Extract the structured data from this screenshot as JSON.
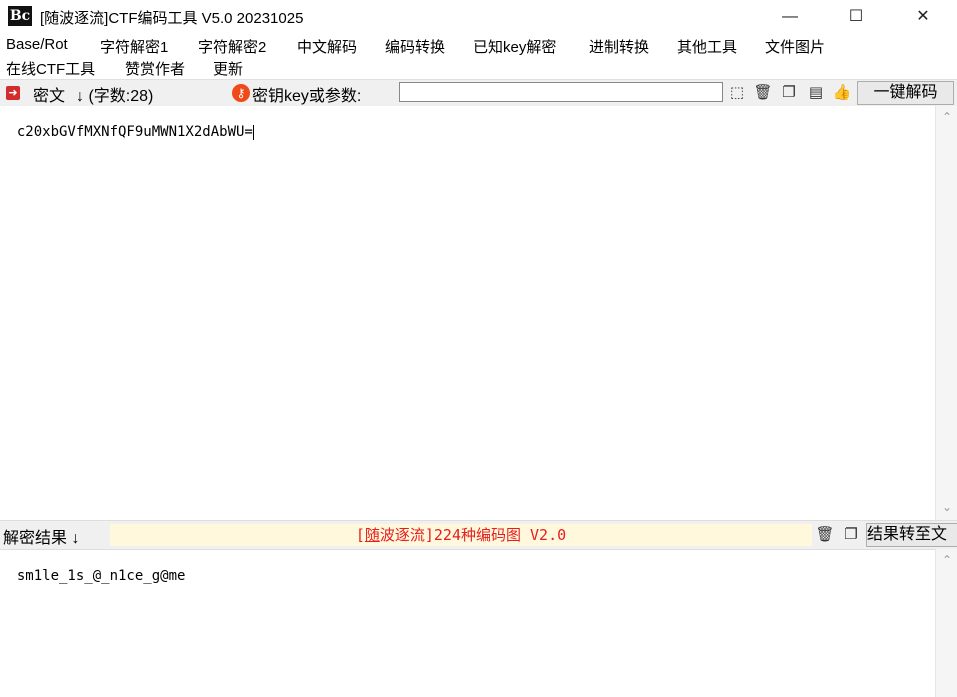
{
  "window": {
    "title": "[随波逐流]CTF编码工具 V5.0 20231025",
    "logo_text": "Bc",
    "minimize": "—",
    "maximize": "☐",
    "close": "✕"
  },
  "menu": {
    "row1": [
      "Base/Rot",
      "字符解密1",
      "字符解密2",
      "中文解码",
      "编码转换",
      "已知key解密",
      "进制转换",
      "其他工具",
      "文件图片"
    ],
    "row2": [
      "在线CTF工具",
      "赞赏作者",
      "更新"
    ]
  },
  "toolbar": {
    "ciphertext_label": "密文",
    "count_label": "↓ (字数:28)",
    "key_label": "密钥key或参数:",
    "key_value": "",
    "decode_button": "一键解码"
  },
  "input": {
    "text": "c20xbGVfMXNfQF9uMWN1X2dAbWU="
  },
  "result": {
    "label": "解密结果 ↓",
    "banner_prefix": "[",
    "banner_link": "随",
    "banner_rest": "波逐流]224种编码图 V2.0",
    "transfer_button": "结果转至文"
  },
  "output": {
    "text": "sm1le_1s_@_n1ce_g@me"
  },
  "colors": {
    "accent_red": "#e51e1e",
    "banner_bg": "#fff8dc",
    "toolbar_bg": "#f0f0f0"
  },
  "icons": [
    "cursor-select-icon",
    "trash-icon",
    "copy-icon",
    "paste-icon",
    "thumbs-up-icon",
    "trash-icon",
    "copy-icon"
  ]
}
